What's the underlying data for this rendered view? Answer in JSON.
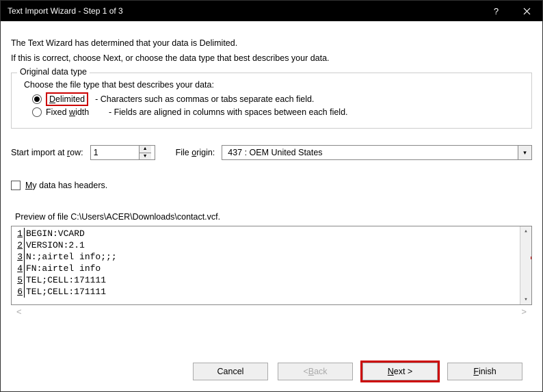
{
  "titlebar": {
    "title": "Text Import Wizard - Step 1 of 3"
  },
  "intro": {
    "line1": "The Text Wizard has determined that your data is Delimited.",
    "line2": "If this is correct, choose Next, or choose the data type that best describes your data."
  },
  "datatype_group": {
    "legend": "Original data type",
    "description": "Choose the file type that best describes your data:",
    "options": [
      {
        "label_pre": "",
        "label_ul": "D",
        "label_post": "elimited",
        "caption": "- Characters such as commas or tabs separate each field.",
        "selected": true
      },
      {
        "label_pre": "Fixed ",
        "label_ul": "w",
        "label_post": "idth",
        "caption": "- Fields are aligned in columns with spaces between each field.",
        "selected": false
      }
    ]
  },
  "import_row": {
    "start_label_pre": "Start import at ",
    "start_label_ul": "r",
    "start_label_post": "ow:",
    "start_value": "1",
    "origin_label_pre": "File ",
    "origin_label_ul": "o",
    "origin_label_post": "rigin:",
    "origin_value": "437 : OEM United States"
  },
  "headers_checkbox": {
    "label_ul": "M",
    "label_post": "y data has headers."
  },
  "preview": {
    "label": "Preview of file C:\\Users\\ACER\\Downloads\\contact.vcf.",
    "lines": [
      {
        "n": "1",
        "t": "BEGIN:VCARD"
      },
      {
        "n": "2",
        "t": "VERSION:2.1"
      },
      {
        "n": "3",
        "t": "N:;airtel info;;;"
      },
      {
        "n": "4",
        "t": "FN:airtel info"
      },
      {
        "n": "5",
        "t": "TEL;CELL:171111"
      },
      {
        "n": "6",
        "t": "TEL;CELL:171111"
      }
    ]
  },
  "buttons": {
    "cancel": "Cancel",
    "back_lt": "< ",
    "back_ul": "B",
    "back_post": "ack",
    "next_ul": "N",
    "next_post": "ext >",
    "finish_ul": "F",
    "finish_post": "inish"
  }
}
